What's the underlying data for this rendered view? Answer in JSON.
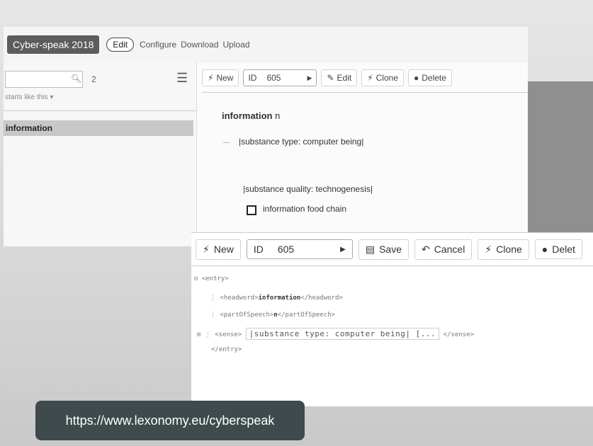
{
  "app": {
    "title": "Cyber-speak 2018",
    "nav": {
      "edit": "Edit",
      "configure": "Configure",
      "download": "Download",
      "upload": "Upload"
    }
  },
  "sidebar": {
    "search_value": "",
    "count": "2",
    "starts_like": "starts like this",
    "entries": [
      "information"
    ]
  },
  "toolbar_view": {
    "new": "New",
    "id_label": "ID",
    "id_value": "605",
    "edit": "Edit",
    "clone": "Clone",
    "delete": "Delete"
  },
  "entry": {
    "headword": "information",
    "pos": "n",
    "senses": [
      "|substance type: computer being|",
      "|substance quality: technogenesis|",
      "information food chain"
    ]
  },
  "toolbar_edit": {
    "new": "New",
    "id_label": "ID",
    "id_value": "605",
    "save": "Save",
    "cancel": "Cancel",
    "clone": "Clone",
    "delete": "Delet"
  },
  "xml": {
    "entry_open": "<entry>",
    "headword_open": "<headword>",
    "headword_text": "information",
    "headword_close": "</headword>",
    "pos_open": "<partOfSpeech>",
    "pos_text": "n",
    "pos_close": "</partOfSpeech>",
    "sense_open": "<sense>",
    "sense_value": "|substance type: computer being| [...",
    "sense_close": "</sense>",
    "entry_close": "</entry>"
  },
  "url": "https://www.lexonomy.eu/cyberspeak"
}
